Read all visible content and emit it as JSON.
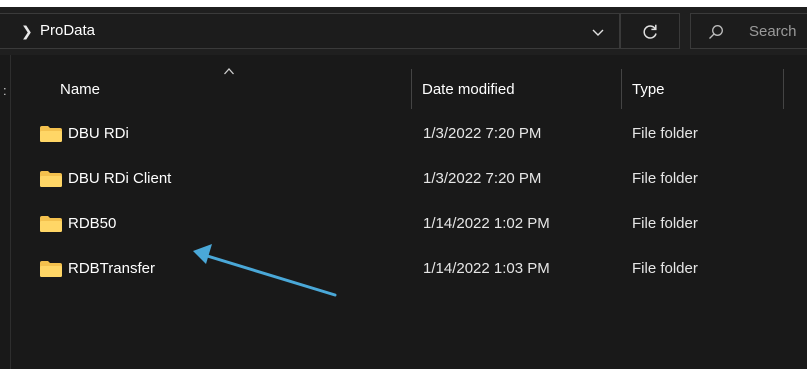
{
  "address_bar": {
    "breadcrumb": "ProData",
    "search_placeholder": "Search"
  },
  "columns": {
    "name": "Name",
    "date_modified": "Date modified",
    "type": "Type"
  },
  "files": [
    {
      "name": "DBU RDi",
      "date": "1/3/2022 7:20 PM",
      "type": "File folder"
    },
    {
      "name": "DBU RDi Client",
      "date": "1/3/2022 7:20 PM",
      "type": "File folder"
    },
    {
      "name": "RDB50",
      "date": "1/14/2022 1:02 PM",
      "type": "File folder"
    },
    {
      "name": "RDBTransfer",
      "date": "1/14/2022 1:03 PM",
      "type": "File folder"
    }
  ],
  "icons": {
    "folder": "folder-icon",
    "refresh": "refresh-icon",
    "search": "search-icon",
    "dropdown": "chevron-down-icon"
  },
  "colors": {
    "folder": "#f4c14e",
    "annotation_arrow": "#4aa8d8",
    "background": "#191919"
  }
}
